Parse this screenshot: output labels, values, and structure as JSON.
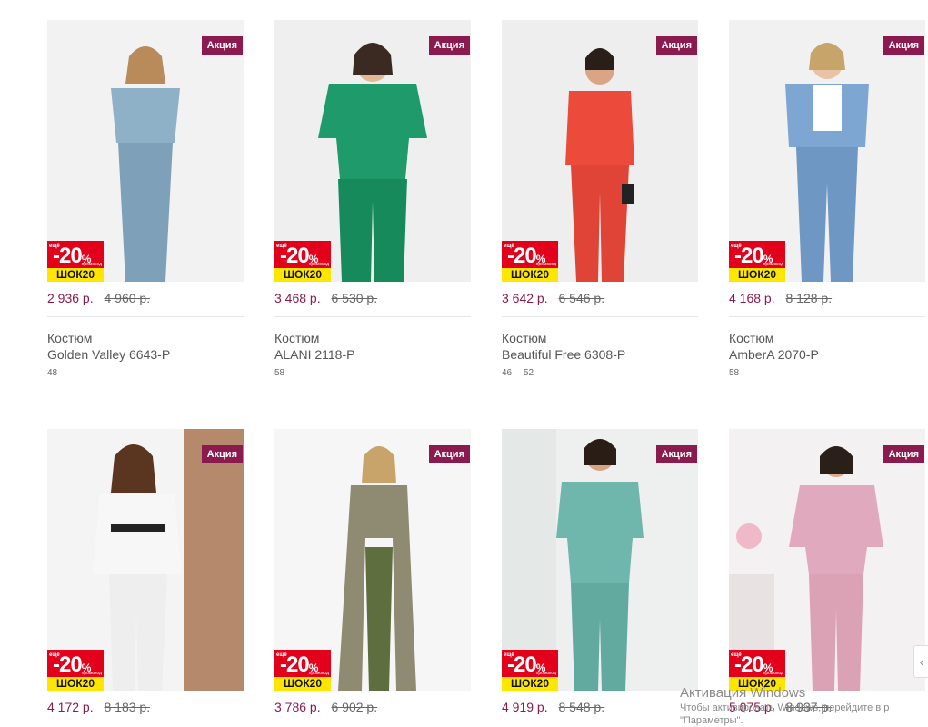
{
  "labels": {
    "sale_badge": "Акция",
    "promo_pct": "-20",
    "promo_pct_sign": "%",
    "promo_code": "ШОК20",
    "promo_small_top": "ещё",
    "promo_small_bottom": "промокод"
  },
  "products": [
    {
      "price": "2 936 р.",
      "old_price": "4 960 р.",
      "type": "Костюм",
      "name": "Golden Valley 6643-Р",
      "sizes": [
        "48"
      ],
      "outfit_colors": [
        "#8fb1c8",
        "#7fa0b9"
      ]
    },
    {
      "price": "3 468 р.",
      "old_price": "6 530 р.",
      "type": "Костюм",
      "name": "ALANI 2118-Р",
      "sizes": [
        "58"
      ],
      "outfit_colors": [
        "#1f9a6a",
        "#178a5c"
      ]
    },
    {
      "price": "3 642 р.",
      "old_price": "6 546 р.",
      "type": "Костюм",
      "name": "Beautiful Free 6308-Р",
      "sizes": [
        "46",
        "52"
      ],
      "outfit_colors": [
        "#ec4b3c",
        "#e04436"
      ]
    },
    {
      "price": "4 168 р.",
      "old_price": "8 128 р.",
      "type": "Костюм",
      "name": "AmberA 2070-Р",
      "sizes": [
        "58"
      ],
      "outfit_colors": [
        "#7ea6d2",
        "#6f97c4"
      ]
    },
    {
      "price": "4 172 р.",
      "old_price": "8 183 р.",
      "outfit_colors": [
        "#f7f7f7",
        "#eeeeee"
      ]
    },
    {
      "price": "3 786 р.",
      "old_price": "6 902 р.",
      "outfit_colors": [
        "#8f8a72",
        "#5f6e3e"
      ]
    },
    {
      "price": "4 919 р.",
      "old_price": "8 548 р.",
      "outfit_colors": [
        "#6fb7ad",
        "#62aaa0"
      ]
    },
    {
      "price": "5 075 р.",
      "old_price": "8 937 р.",
      "outfit_colors": [
        "#e1a9bd",
        "#dba1b5"
      ]
    }
  ],
  "windows_activation": {
    "title": "Активация Windows",
    "text": "Чтобы активировать Windows, перейдите в р",
    "text2": "\"Параметры\"."
  }
}
